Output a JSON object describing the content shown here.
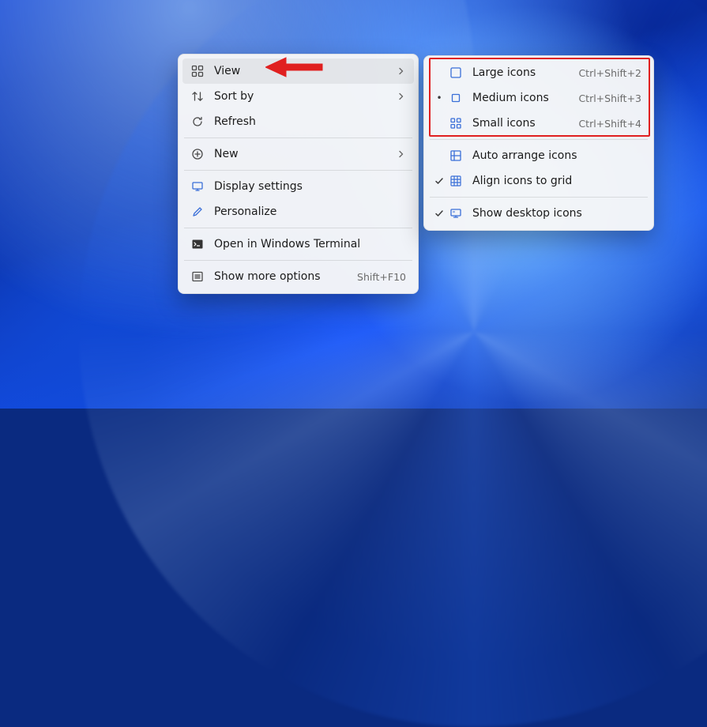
{
  "context_menu": {
    "view": {
      "label": "View"
    },
    "sort_by": {
      "label": "Sort by"
    },
    "refresh": {
      "label": "Refresh"
    },
    "new": {
      "label": "New"
    },
    "display_settings": {
      "label": "Display settings"
    },
    "personalize": {
      "label": "Personalize"
    },
    "open_terminal": {
      "label": "Open in Windows Terminal"
    },
    "show_more": {
      "label": "Show more options",
      "accel": "Shift+F10"
    }
  },
  "view_submenu": {
    "large": {
      "label": "Large icons",
      "accel": "Ctrl+Shift+2"
    },
    "medium": {
      "label": "Medium icons",
      "accel": "Ctrl+Shift+3"
    },
    "small": {
      "label": "Small icons",
      "accel": "Ctrl+Shift+4"
    },
    "auto_arrange": {
      "label": "Auto arrange icons"
    },
    "align_grid": {
      "label": "Align icons to grid"
    },
    "show_desktop": {
      "label": "Show desktop icons"
    }
  },
  "annotation": {
    "arrow_color": "#e02020",
    "highlight_color": "#e02020"
  }
}
